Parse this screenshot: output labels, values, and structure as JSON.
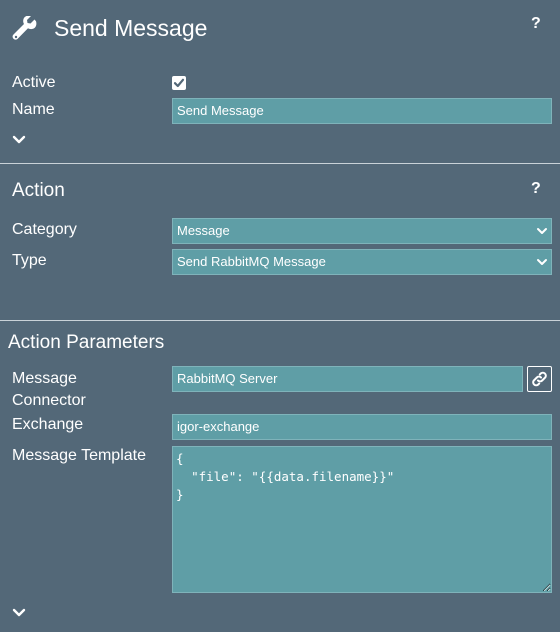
{
  "header": {
    "title": "Send Message",
    "icon": "wrench-icon",
    "help": "?"
  },
  "general": {
    "active_label": "Active",
    "active_checked": true,
    "name_label": "Name",
    "name_value": "Send Message"
  },
  "action": {
    "title": "Action",
    "help": "?",
    "category_label": "Category",
    "category_value": "Message",
    "type_label": "Type",
    "type_value": "Send RabbitMQ Message"
  },
  "params": {
    "title": "Action Parameters",
    "connector_label_line1": "Message",
    "connector_label_line2": "Connector",
    "connector_value": "RabbitMQ Server",
    "exchange_label": "Exchange",
    "exchange_value": "igor-exchange",
    "template_label": "Message Template",
    "template_value": "{\n  \"file\": \"{{data.filename}}\"\n}"
  },
  "colors": {
    "background": "#536878",
    "field": "#5f9ea6",
    "divider": "#c9d2d8"
  }
}
